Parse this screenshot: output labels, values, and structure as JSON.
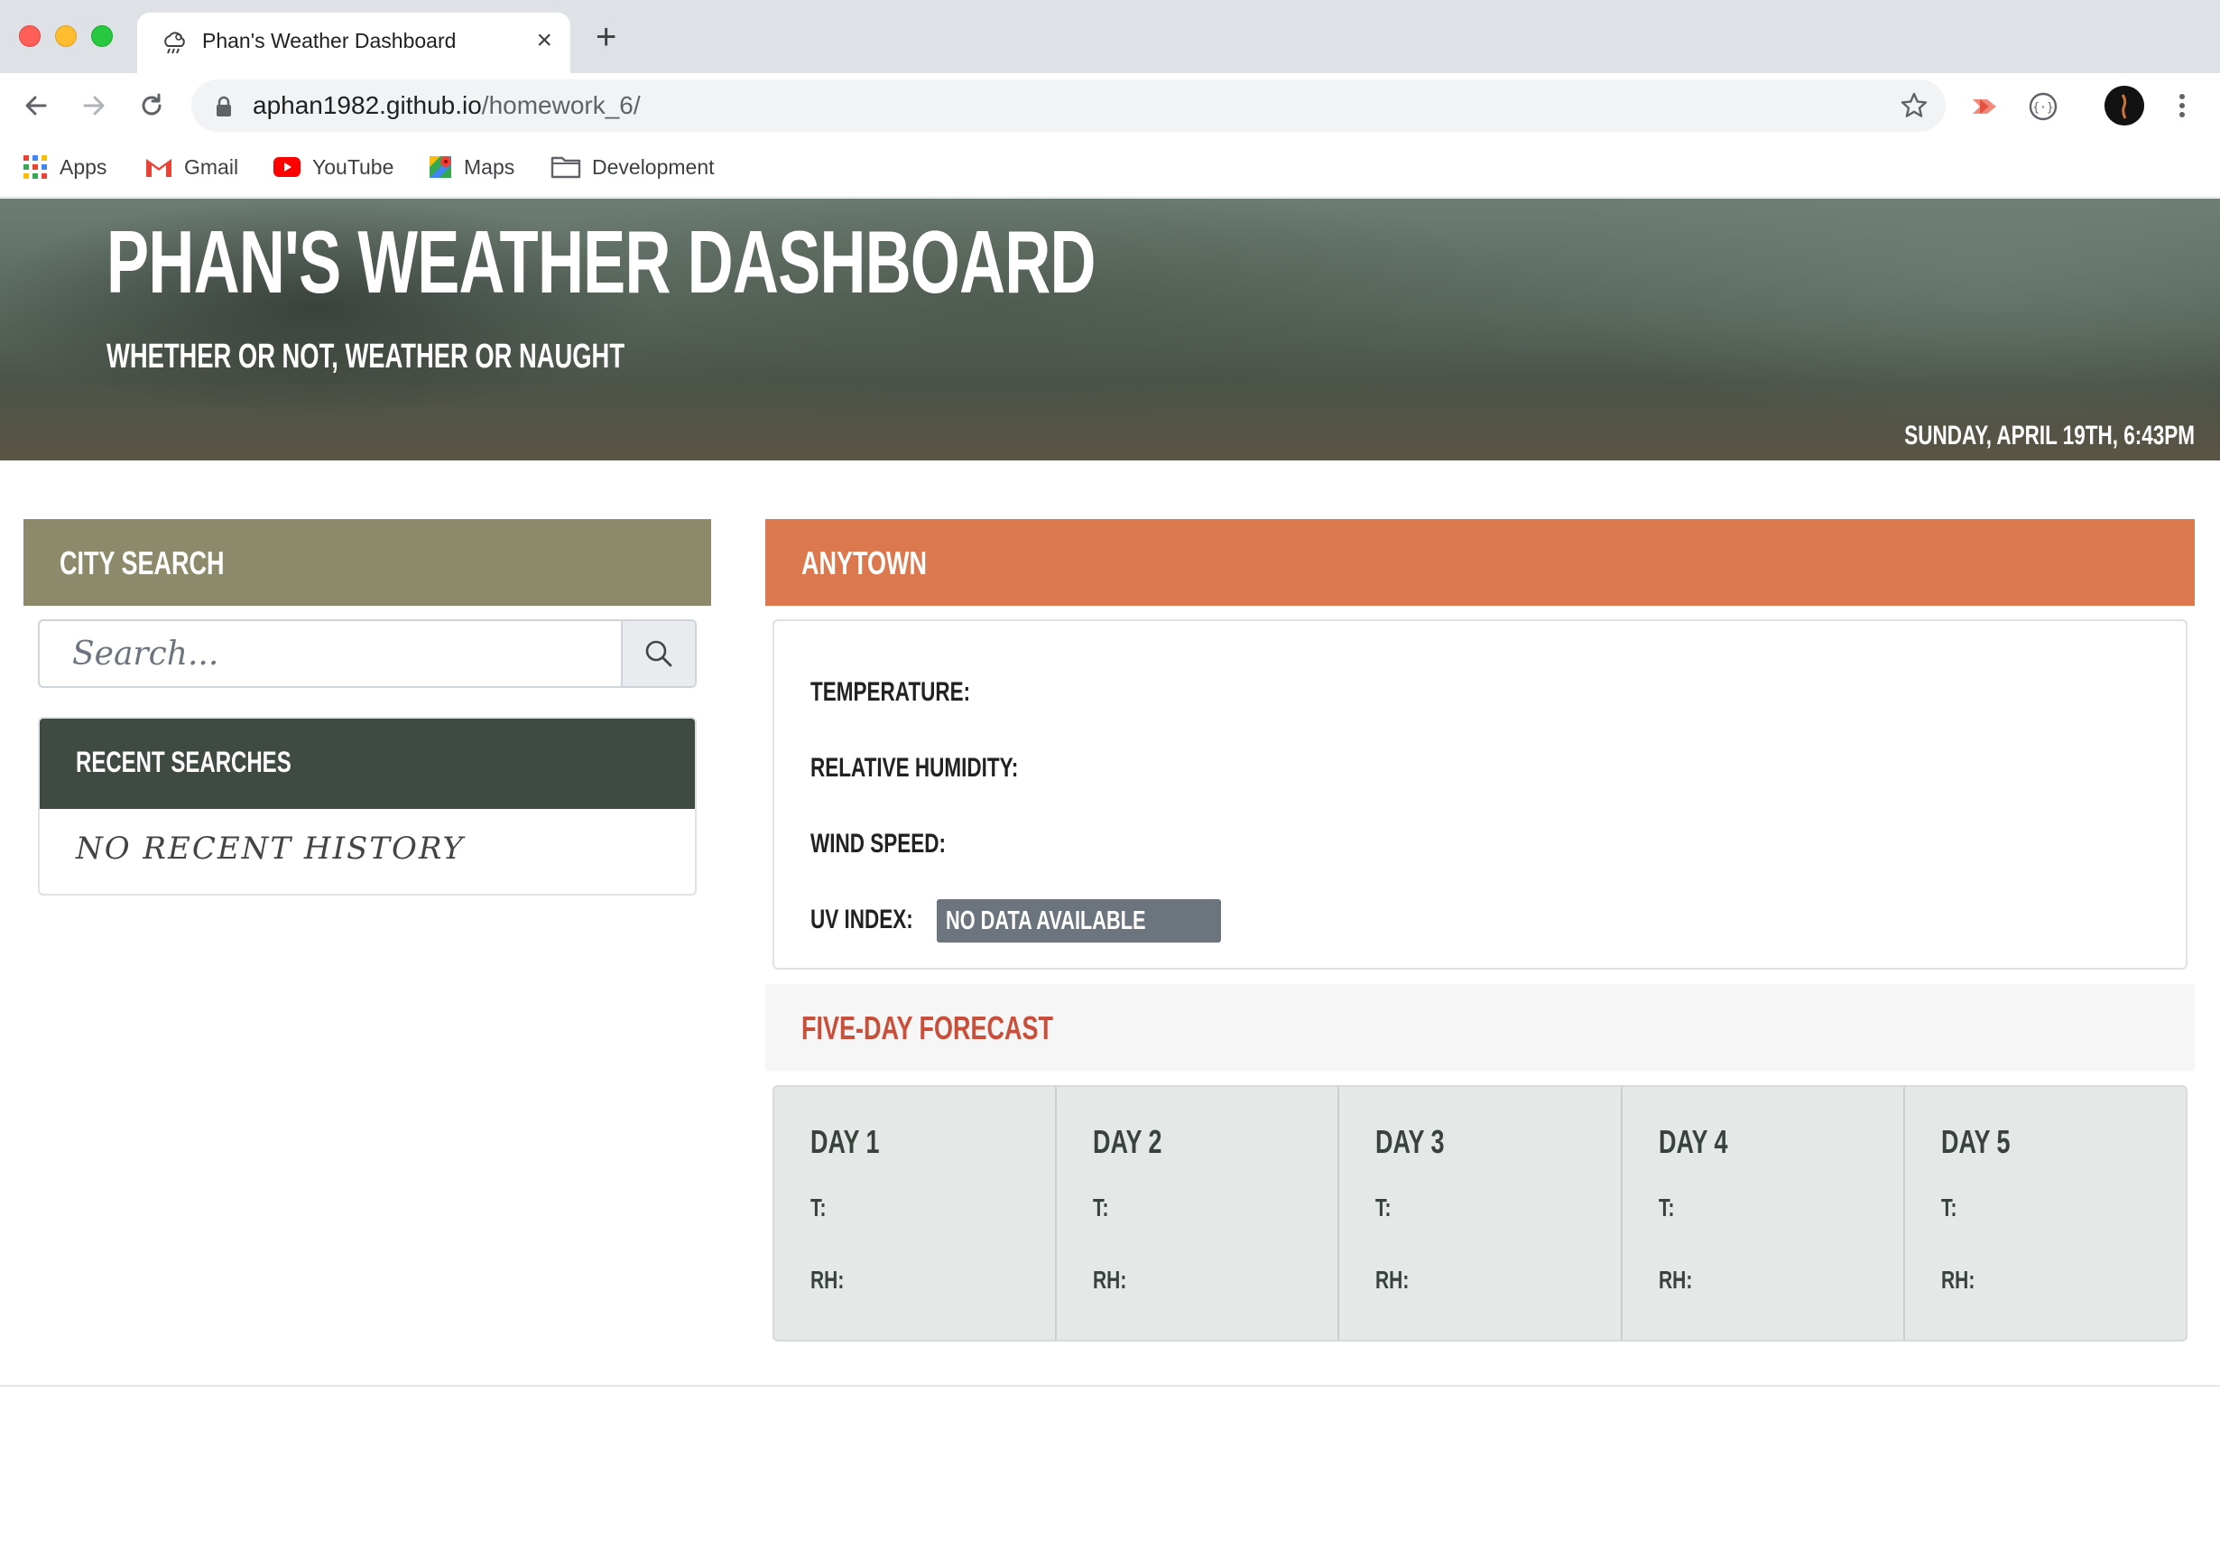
{
  "browser": {
    "tab_title": "Phan's Weather Dashboard",
    "url_host": "aphan1982.github.io",
    "url_path": "/homework_6/",
    "bookmarks": [
      {
        "label": "Apps",
        "icon": "apps-grid-icon"
      },
      {
        "label": "Gmail",
        "icon": "gmail-icon"
      },
      {
        "label": "YouTube",
        "icon": "youtube-icon"
      },
      {
        "label": "Maps",
        "icon": "maps-icon"
      },
      {
        "label": "Development",
        "icon": "folder-icon"
      }
    ]
  },
  "hero": {
    "title": "PHAN'S WEATHER DASHBOARD",
    "subtitle": "WHETHER OR NOT, WEATHER OR NAUGHT",
    "datetime": "SUNDAY, APRIL 19TH, 6:43PM"
  },
  "search": {
    "header": "CITY SEARCH",
    "placeholder": "Search...",
    "recent_header": "RECENT SEARCHES",
    "recent_empty": "NO RECENT HISTORY"
  },
  "current": {
    "city": "ANYTOWN",
    "temperature_label": "TEMPERATURE:",
    "temperature_value": "",
    "humidity_label": "RELATIVE HUMIDITY:",
    "humidity_value": "",
    "wind_label": "WIND SPEED:",
    "wind_value": "",
    "uv_label": "UV INDEX:",
    "uv_value": "NO DATA AVAILABLE"
  },
  "forecast": {
    "header": "FIVE-DAY FORECAST",
    "days": [
      {
        "title": "DAY 1",
        "t_label": "T:",
        "rh_label": "RH:"
      },
      {
        "title": "DAY 2",
        "t_label": "T:",
        "rh_label": "RH:"
      },
      {
        "title": "DAY 3",
        "t_label": "T:",
        "rh_label": "RH:"
      },
      {
        "title": "DAY 4",
        "t_label": "T:",
        "rh_label": "RH:"
      },
      {
        "title": "DAY 5",
        "t_label": "T:",
        "rh_label": "RH:"
      }
    ]
  },
  "colors": {
    "city_search_header": "#8d8a6b",
    "recent_header": "#3f4a42",
    "city_header": "#dc784e",
    "forecast_title": "#c94f3a",
    "uv_badge": "#6c757d"
  }
}
